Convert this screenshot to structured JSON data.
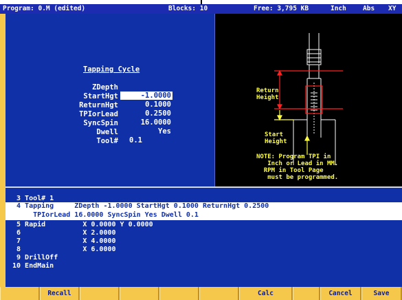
{
  "status": {
    "program": "Program: 0.M (edited)",
    "blocks": "Blocks: 10",
    "free": "Free: 3,795 KB",
    "units": "Inch",
    "mode": "Abs",
    "axes": "XY"
  },
  "form": {
    "title": "Tapping Cycle",
    "params": [
      {
        "label": "ZDepth",
        "value": "-1.0000"
      },
      {
        "label": "StartHgt",
        "value": "0.1000"
      },
      {
        "label": "ReturnHgt",
        "value": "0.2500"
      },
      {
        "label": "TPIorLead",
        "value": "16.0000"
      },
      {
        "label": "SyncSpin",
        "value": "Yes"
      },
      {
        "label": "Dwell",
        "value": "0.1"
      },
      {
        "label": "Tool#",
        "value": ""
      }
    ]
  },
  "diagram": {
    "return_height": "Return\nHeight",
    "start_height": "Start\nHeight",
    "note": "NOTE: Program TPI in\n   Inch or Lead in MM.\n  RPM in Tool Page\n   must be programmed."
  },
  "program": {
    "lines": [
      " 3 Tool# 1",
      " 4 Tapping     ZDepth -1.0000 StartHgt 0.1000 ReturnHgt 0.2500",
      "     TPIorLead 16.0000 SyncSpin Yes Dwell 0.1",
      " 5 Rapid         X 0.0000 Y 0.0000",
      " 6               X 2.0000",
      " 7               X 4.0000",
      " 8               X 6.0000",
      " 9 DrillOff",
      "10 EndMain"
    ]
  },
  "softkeys": [
    "",
    "Recall",
    "",
    "",
    "",
    "",
    "Calc",
    "",
    "Cancel",
    "Save"
  ],
  "colors": {
    "screen_bg": "#1030a8",
    "status_bg": "#1c2bb0",
    "softkey_bg": "#f5c84b",
    "diagram_text": "#ffff40",
    "diagram_lines": "#ff2020"
  }
}
